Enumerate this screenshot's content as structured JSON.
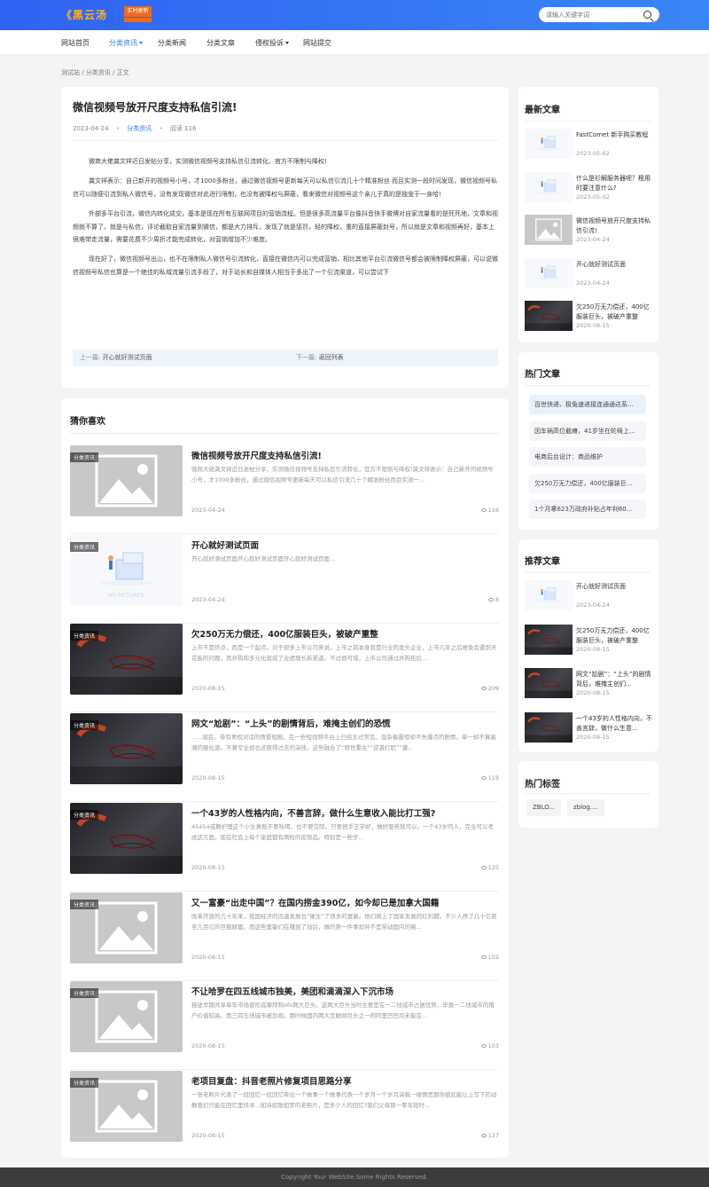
{
  "header": {
    "logo_text": "《黑云汤",
    "logo_badge": "实时更新",
    "search_placeholder": "请输入关键字词"
  },
  "nav": {
    "items": [
      {
        "label": "网站首页"
      },
      {
        "label": "分类资讯",
        "active": true,
        "has_dropdown": true
      },
      {
        "label": "分类新闻"
      },
      {
        "label": "分类文章"
      },
      {
        "label": "侵权投诉",
        "has_dropdown": true
      },
      {
        "label": "网站提交"
      }
    ]
  },
  "breadcrumb": "测试站 / 分类资讯 / 正文",
  "article": {
    "title": "微信视频号放开尺度支持私信引流!",
    "date": "2023-04-24",
    "category": "分类资讯",
    "views": "阅读 116",
    "paragraphs": [
      "微商大佬龚文祥近日发帖分享，实测微信视频号支持私信引流转化，官方不限制与降权!",
      "龚文祥表示：自己新开的视频号小号，才1000多粉丝，通过微信视频号更新每天可以私信引流几十个精准粉丝 而且实测一段时间发现，微信视频号私信可以随便引流到私人微信号，没有发现微信对此进行限制，也没有被降权与屏蔽，看来微信对视频号这个亲儿子真的是独宠于一身哈!",
      "外部多平台引流，微信内转化成交，基本是现在所有互联网项目的营销流程。但是很多高流量平台像抖音快手微博对自家流量看的是死死地，文章和视频就不算了，就是与私信，评论截取自家流量到微信，都是大力排斥，发现了就是惩罚，轻的降权，重的直接屏蔽封号，所以就是文章和视频再好，基本上很难带走流量，需要花费不少周折才能完成转化，对营销增加不少难度。",
      "现在好了，微信视频号出山，也不在限制私人微信号引流转化，直接在微信内可以完成营销，相比其他平台引流微信号都会被限制降权屏蔽，可以说微信视频号私信也算是一个绝佳的私域流量引流手段了，对于站长和自媒体人相当于多出了一个引流渠道，可以尝试下"
    ],
    "prev_label": "上一篇:",
    "prev_title": "开心就好测试页面",
    "next_label": "下一篇:",
    "next_title": "返回列表"
  },
  "recommend": {
    "title": "猜你喜欢",
    "items": [
      {
        "title": "微信视频号放开尺度支持私信引流!",
        "excerpt": "微商大佬龚文祥近日发帖分享，实测微信视频号支持私信引流转化，官方不限制与降权!龚文祥表示：自己新开的视频号小号，才1000多粉丝，通过微信视频号更新每天可以私信引流几十个精准粉丝而且实测一...",
        "date": "2023-04-24",
        "views": "116",
        "tag": "分类资讯",
        "thumb": "placeholder"
      },
      {
        "title": "开心就好测试页面",
        "excerpt": "开心就好测试页面开心就好测试页面开心就好测试页面...",
        "date": "2023-04-24",
        "views": "8",
        "tag": "分类资讯",
        "thumb": "no-picture",
        "thumb_text": "NO PICTURES"
      },
      {
        "title": "欠250万无力偿还，400亿服装巨头，被破产重整",
        "excerpt": "上市不是终点，而是一个起点。对于很多上市公司来说，上市之前本身就是行业的龙头企业，上市几年之后难免会遇到天花板的问题，而并购和多元化就成了业绩增长新渠道。不过很可惜，上市公司通过并购拓后...",
        "date": "2020-08-15",
        "views": "209",
        "tag": "分类资讯",
        "thumb": "dark"
      },
      {
        "title": "网文“尬剧”：“上头”的剧情背后，难掩主创们的恐慌",
        "excerpt": "......现在，带有男权对话的情景短剧，在一些短视频平台上已经太过常见。混杂着震惊却不失爆点的剧情，单一却不算高潮的服化道，不算专业却也还原得过去的演技，这些融合了“转世重生”“逆袭打脸”“豪...",
        "date": "2020-08-15",
        "views": "119",
        "tag": "分类资讯",
        "thumb": "dark"
      },
      {
        "title": "一个43岁的人性格内向，不善言辞，做什么生意收入能比打工强?",
        "excerpt": "45454或舞护理这个小生意既不要吆喝，也不要交际。只要把手艺学好，做好服务就可以。一个43岁的人，完全可以考虑这方面。现在社会上每个家庭都有两粒的皮制品。特别是一些步...",
        "date": "2020-08-15",
        "views": "125",
        "tag": "分类资讯",
        "thumb": "dark"
      },
      {
        "title": "又一富豪“出走中国”？在国内捞金390亿，如今却已是加拿大国籍",
        "excerpt": "改革开放的几十年来，我国经济的迅速发展也“催生”了很多的富豪。他们顺上了国家发展的红利期，不少人挣了几十亿甚至几百亿的巨额财富。而这些富豪们在赚到了钱后，做的第一件事却并不是带动国内的剩...",
        "date": "2020-08-15",
        "views": "102",
        "tag": "分类资讯",
        "thumb": "placeholder"
      },
      {
        "title": "不让哈罗在四五线城市独美，美团和滴滴深入下沉市场",
        "excerpt": "描述早期共享单车市场曾形成摩拜和ofo两大巨头。这两大巨头当时主要是在一二线城市占据优势，毕竟一二线城市的用户价值较高，而三四五线城市被忽视。那时候国内两大互联网巨头之一的阿里巴巴均未能在...",
        "date": "2020-08-15",
        "views": "103",
        "tag": "分类资讯",
        "thumb": "placeholder"
      },
      {
        "title": "老项目复盘：抖音老照片修复项目思路分享",
        "excerpt": "一张老照片代表了一段回忆一段回忆牵出一个故事一个故事代表一个岁月一个岁月演载一缕情思那你彼此能让上写下的动静我们只能在回忆里找寻...如诗如歌如梦的老照片，是多少人的回忆?我们父母那一辈年轻时...",
        "date": "2020-08-15",
        "views": "127",
        "tag": "分类资讯",
        "thumb": "placeholder"
      }
    ]
  },
  "sidebar": {
    "latest_title": "最新文章",
    "latest": [
      {
        "title": "FastComet 新手购买教程",
        "date": "2023-05-02",
        "thumb": "light"
      },
      {
        "title": "什么是衫解服务器呢？租用时要注意什么?",
        "date": "2023-05-02",
        "thumb": "light"
      },
      {
        "title": "微信视频号放开尺度支持私信引流!",
        "date": "2023-04-24",
        "thumb": "placeholder"
      },
      {
        "title": "开心就好测试页面",
        "date": "2023-04-24",
        "thumb": "light"
      },
      {
        "title": "欠250万无力偿还，400亿服装巨头，被破产重整",
        "date": "2020-08-15",
        "thumb": "dark"
      }
    ],
    "hot_title": "热门文章",
    "hot": [
      "百世快递、极兔速递接连通通达系...",
      "因车祸高位截瘫，41岁坐在轮椅上...",
      "电商后台设计：商品维护",
      "欠250万无力偿还，400亿服装巨...",
      "1个月拿623万政府补贴占年利60..."
    ],
    "featured_title": "推荐文章",
    "featured": [
      {
        "title": "开心就好测试页面",
        "date": "2023-04-24",
        "thumb": "light"
      },
      {
        "title": "欠250万无力偿还，400亿服装巨头，被破产重整",
        "date": "2020-08-15",
        "thumb": "dark"
      },
      {
        "title": "网文“尬剧”：“上头”的剧情背后，难掩主创们...",
        "date": "2020-08-15",
        "thumb": "dark"
      },
      {
        "title": "一个43岁的人性格内向，不善言辞，做什么生意...",
        "date": "2020-08-15",
        "thumb": "dark"
      }
    ],
    "tags_title": "热门标签",
    "tags": [
      "ZBLO...",
      "zblog...."
    ]
  },
  "footer": "Copyright Your WebSite.Some Rights Reserved."
}
